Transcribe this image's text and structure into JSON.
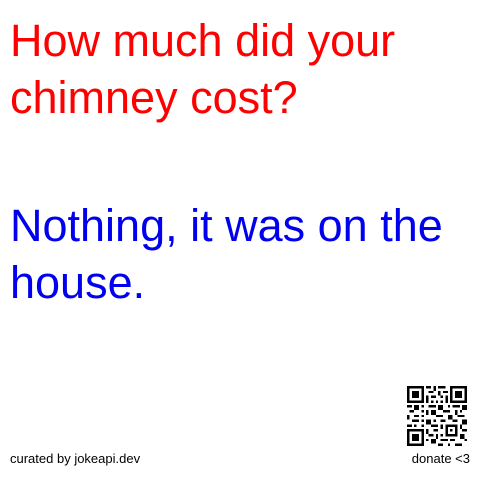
{
  "joke": {
    "setup": "How much did your chimney cost?",
    "delivery": "Nothing, it was on the house."
  },
  "footer": {
    "credit": "curated by jokeapi.dev",
    "donate": "donate <3"
  },
  "colors": {
    "setup": "#ff0000",
    "delivery": "#0000ee",
    "footer": "#000000",
    "background": "#ffffff"
  },
  "qr_code": {
    "icon": "qr-code-icon"
  }
}
